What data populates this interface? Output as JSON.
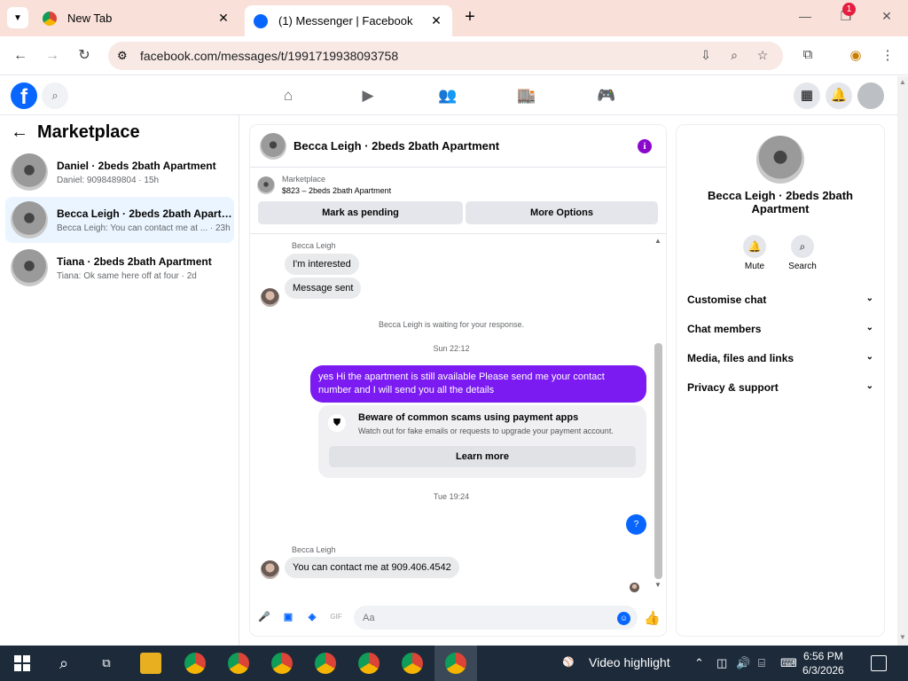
{
  "browser": {
    "tabs": [
      {
        "title": "New Tab"
      },
      {
        "title": "(1) Messenger | Facebook"
      }
    ],
    "url": "facebook.com/messages/t/1991719938093758"
  },
  "fb_header": {
    "notification_count": "1"
  },
  "left": {
    "title": "Marketplace",
    "conversations": [
      {
        "name": "Daniel · 2beds 2bath Apartment",
        "preview": "Daniel: 9098489804 · 15h"
      },
      {
        "name": "Becca Leigh · 2beds 2bath Apartment",
        "preview": "Becca Leigh: You can contact me at ... · 23h"
      },
      {
        "name": "Tiana · 2beds 2bath Apartment",
        "preview": "Tiana: Ok same here off at four · 2d"
      }
    ]
  },
  "chat": {
    "title": "Becca Leigh · 2beds 2bath Apartment",
    "listing_label": "Marketplace",
    "listing": "$823 – 2beds 2bath Apartment",
    "mark_pending": "Mark as pending",
    "more_options": "More Options",
    "messages": {
      "sender1": "Becca Leigh",
      "m1": "I'm interested",
      "m2": "Message sent",
      "waiting": "Becca Leigh is waiting for your response.",
      "time1": "Sun 22:12",
      "out1": "yes Hi the apartment is still available Please send me your contact number and I will send you all the details",
      "scam_title": "Beware of common scams using payment apps",
      "scam_desc": "Watch out for fake emails or requests to upgrade your payment account.",
      "scam_btn": "Learn more",
      "time2": "Tue 19:24",
      "out2": "?",
      "sender2": "Becca Leigh",
      "m3": "You can contact me at 909.406.4542"
    },
    "composer_placeholder": "Aa"
  },
  "right": {
    "name": "Becca Leigh · 2beds 2bath Apartment",
    "mute": "Mute",
    "search": "Search",
    "rows": [
      "Customise chat",
      "Chat members",
      "Media, files and links",
      "Privacy & support"
    ]
  },
  "taskbar": {
    "news": "Video highlight",
    "time": "6:56 PM",
    "date": "6/3/2026"
  }
}
